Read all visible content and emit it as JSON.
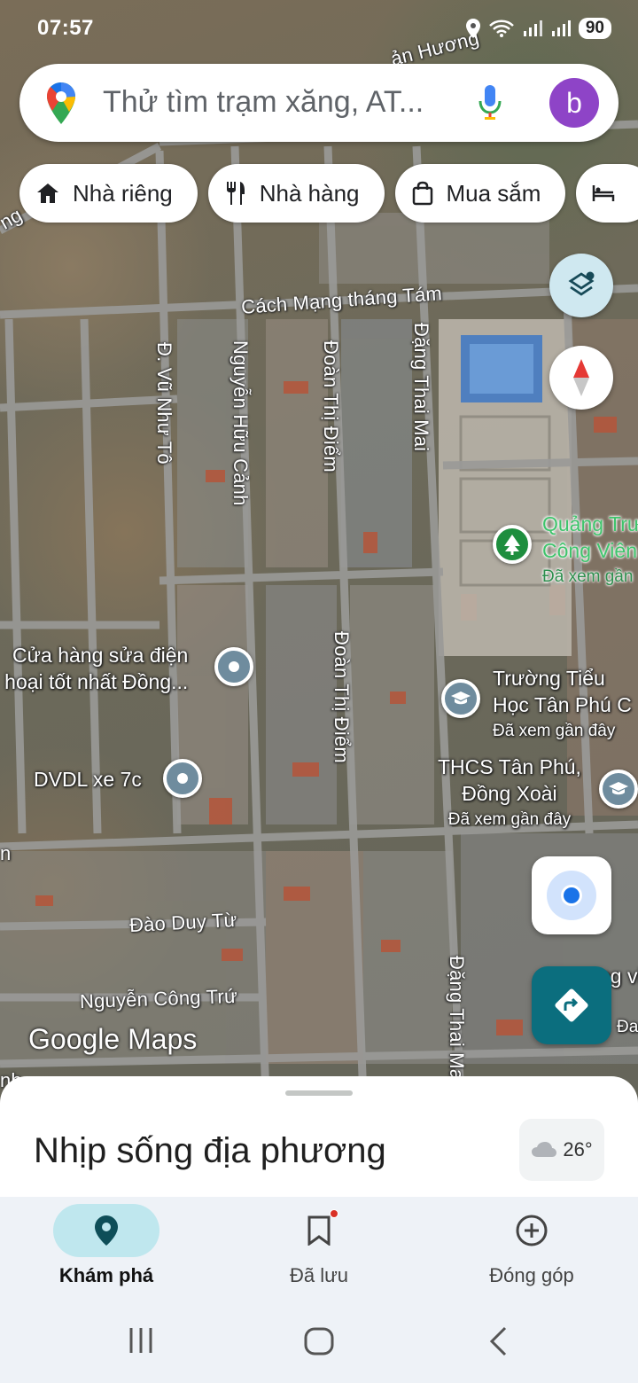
{
  "status_bar": {
    "time": "07:57",
    "battery": "90"
  },
  "search": {
    "placeholder": "Thử tìm trạm xăng, AT...",
    "avatar_letter": "b"
  },
  "chips": [
    {
      "label": "Nhà riêng",
      "icon": "home-icon"
    },
    {
      "label": "Nhà hàng",
      "icon": "restaurant-icon"
    },
    {
      "label": "Mua sắm",
      "icon": "shopping-bag-icon"
    }
  ],
  "map": {
    "road_labels": {
      "top_partial": "ản Hương",
      "cach_mang": "Cách Mạng tháng Tám",
      "vu_nhu_to": "Đ. Vũ Như Tô",
      "nguyen_huu_canh": "Nguyễn Hữu Cảnh",
      "doan_thi_diem_1": "Đoàn Thị Điểm",
      "doan_thi_diem_2": "Đoàn Thị Điểm",
      "dang_thai_mai_1": "Đặng Thai Mai",
      "dang_thai_mai_2": "Đặng Thai Mai",
      "dao_duy_tu": "Đào Duy Từ",
      "nguyen_cong_tru": "Nguyễn Công Trứ",
      "left_partial_1": "ng",
      "left_partial_2": "n",
      "left_partial_3": "nh"
    },
    "pois": {
      "repair_shop": {
        "line1": "Cửa hàng sửa điện",
        "line2": "hoại tốt nhất Đồng..."
      },
      "dvdl": {
        "name": "DVDL xe 7c"
      },
      "park": {
        "line1": "Quảng Trư",
        "line2": "Công Viên",
        "sub": "Đã xem gần"
      },
      "primary_school": {
        "line1": "Trường Tiểu",
        "line2": "Học Tân Phú C",
        "sub": "Đã xem gần đây"
      },
      "secondary_school": {
        "line1": "THCS Tân Phú,",
        "line2": "Đồng Xoài",
        "sub": "Đã xem gần đây"
      },
      "right_partial_1": "ng vi",
      "right_partial_2": "Đa"
    },
    "watermark": "Google Maps"
  },
  "sheet": {
    "title": "Nhịp sống địa phương",
    "temperature": "26°"
  },
  "bottom_nav": [
    {
      "label": "Khám phá",
      "icon": "explore-pin-icon",
      "active": true
    },
    {
      "label": "Đã lưu",
      "icon": "bookmark-icon",
      "active": false
    },
    {
      "label": "Đóng góp",
      "icon": "add-circle-icon",
      "active": false
    }
  ]
}
